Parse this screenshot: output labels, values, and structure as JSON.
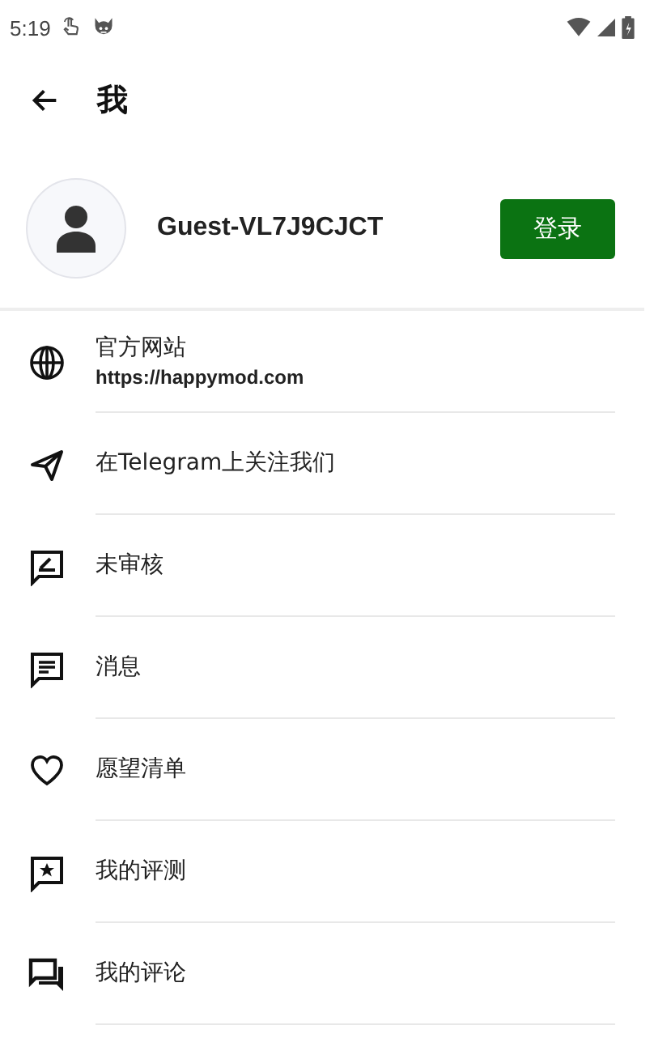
{
  "status_bar": {
    "time": "5:19"
  },
  "header": {
    "title": "我"
  },
  "profile": {
    "name": "Guest-VL7J9CJCT",
    "login_button": "登录"
  },
  "menu": [
    {
      "kind": "globe",
      "label": "官方网站",
      "subtitle": "https://happymod.com"
    },
    {
      "kind": "send",
      "label": "在Telegram上关注我们"
    },
    {
      "kind": "pending",
      "label": "未审核"
    },
    {
      "kind": "message",
      "label": "消息"
    },
    {
      "kind": "heart",
      "label": "愿望清单"
    },
    {
      "kind": "review",
      "label": "我的评测"
    },
    {
      "kind": "comments",
      "label": "我的评论"
    }
  ]
}
